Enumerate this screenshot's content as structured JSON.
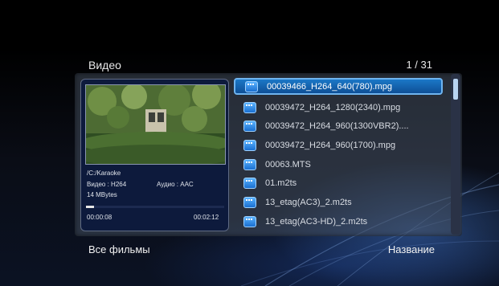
{
  "header": {
    "title": "Видео",
    "page_count": "1 / 31"
  },
  "preview": {
    "path": "/C:/Karaoke",
    "video_codec": "Видео : H264",
    "audio_codec": "Аудио : AAC",
    "size": "14 MBytes",
    "elapsed": "00:00:08",
    "duration": "00:02:12",
    "progress_fraction": 0.06
  },
  "files": [
    {
      "name": "00039466_H264_640(780).mpg",
      "icon": "video-file-icon",
      "selected": true
    },
    {
      "name": "00039472_H264_1280(2340).mpg",
      "icon": "video-file-icon"
    },
    {
      "name": "00039472_H264_960(1300VBR2)....",
      "icon": "video-file-icon"
    },
    {
      "name": "00039472_H264_960(1700).mpg",
      "icon": "video-file-icon"
    },
    {
      "name": "00063.MTS",
      "icon": "video-file-icon"
    },
    {
      "name": "01.m2ts",
      "icon": "video-file-icon"
    },
    {
      "name": "13_etag(AC3)_2.m2ts",
      "icon": "video-file-icon"
    },
    {
      "name": "13_etag(AC3-HD)_2.m2ts",
      "icon": "video-file-icon"
    }
  ],
  "footer": {
    "filter_label": "Все фильмы",
    "sort_label": "Название"
  },
  "colors": {
    "selection": "#1b78c7",
    "selection_border": "#6fb4ef",
    "panel": "#465060",
    "accent_blue": "#3c6ebe"
  }
}
